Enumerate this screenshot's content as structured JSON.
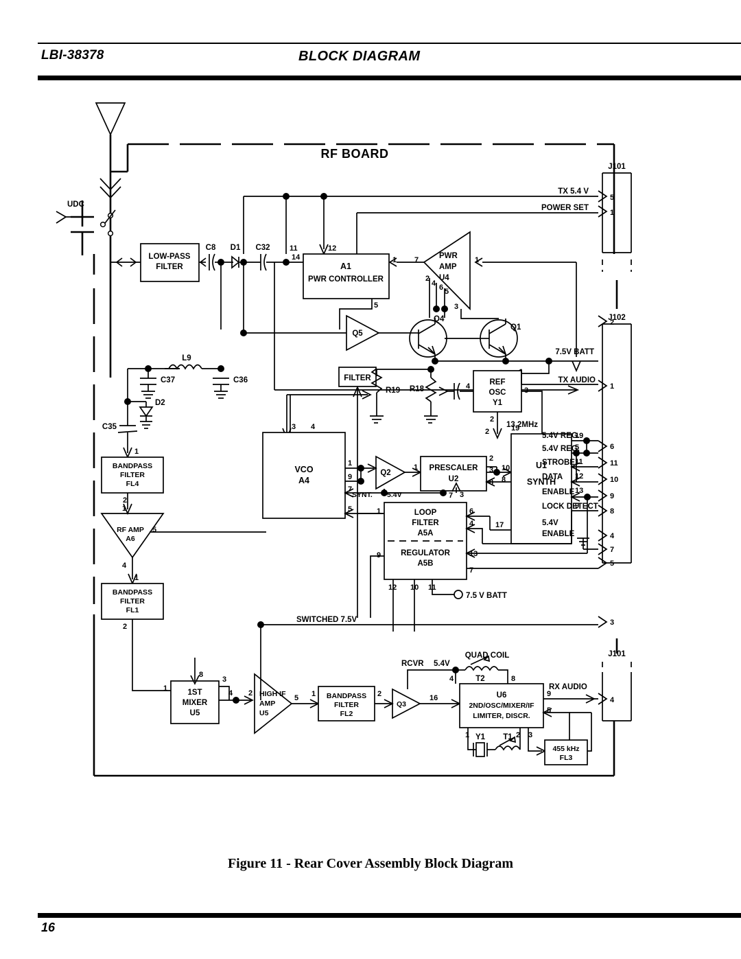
{
  "header": {
    "doc_id": "LBI-38378",
    "title": "BLOCK DIAGRAM"
  },
  "footer": {
    "caption": "Figure 11 - Rear Cover Assembly Block Diagram",
    "page_number": "16"
  },
  "diagram": {
    "board_label": "RF BOARD",
    "antenna_label": "UDC",
    "connectors": [
      {
        "name": "J101",
        "position": "top-right",
        "pins": [
          "5",
          "1"
        ]
      },
      {
        "name": "J102",
        "position": "mid-right",
        "pins": [
          "2"
        ]
      },
      {
        "name": "J101",
        "position": "bottom-right",
        "pins": [
          "4"
        ]
      }
    ],
    "blocks": {
      "low_pass_filter": {
        "l1": "LOW-PASS",
        "l2": "FILTER"
      },
      "pwr_controller": {
        "l1": "A1",
        "l2": "PWR CONTROLLER",
        "pins": [
          "14",
          "11",
          "12",
          "1",
          "5"
        ]
      },
      "pwr_amp": {
        "l1": "PWR",
        "l2": "AMP",
        "l3": "U4",
        "pins": [
          "7",
          "1",
          "2",
          "4",
          "6",
          "5",
          "3"
        ]
      },
      "filter_small": {
        "l1": "FILTER"
      },
      "ref_osc": {
        "l1": "REF",
        "l2": "OSC",
        "l3": "Y1",
        "pins": [
          "4",
          "3",
          "2"
        ],
        "freq": "13.2MHz"
      },
      "vco": {
        "l1": "VCO",
        "l2": "A4",
        "pins": [
          "3",
          "4",
          "1",
          "9",
          "7",
          "5"
        ]
      },
      "prescaler": {
        "l1": "PRESCALER",
        "l2": "U2",
        "pins": [
          "1",
          "2",
          "3",
          "7",
          "8"
        ]
      },
      "synth": {
        "l1": "U1",
        "l2": "SYNTH",
        "pins": [
          "2",
          "19",
          "5",
          "11",
          "12",
          "13",
          "9",
          "10",
          "8",
          "17"
        ]
      },
      "loop_filter": {
        "l1": "LOOP",
        "l2": "FILTER",
        "l3": "A5A",
        "pins": [
          "1",
          "6",
          "4"
        ]
      },
      "regulator": {
        "l1": "REGULATOR",
        "l2": "A5B",
        "pins": [
          "9",
          "13",
          "7",
          "12",
          "10",
          "11"
        ]
      },
      "bandpass_fl4": {
        "l1": "BANDPASS",
        "l2": "FILTER",
        "l3": "FL4",
        "pins": [
          "1",
          "2"
        ]
      },
      "rf_amp": {
        "l1": "RF AMP",
        "l2": "A6",
        "pins": [
          "1",
          "5",
          "4"
        ]
      },
      "bandpass_fl1": {
        "l1": "BANDPASS",
        "l2": "FILTER",
        "l3": "FL1",
        "pins": [
          "1",
          "2"
        ]
      },
      "first_mixer": {
        "l1": "1ST",
        "l2": "MIXER",
        "l3": "U5",
        "pins": [
          "1",
          "8",
          "3",
          "4"
        ]
      },
      "high_if_amp": {
        "l1": "HIGH IF",
        "l2": "AMP",
        "l3": "U5",
        "pins": [
          "2",
          "5"
        ]
      },
      "bandpass_fl2": {
        "l1": "BANDPASS",
        "l2": "FILTER",
        "l3": "FL2",
        "pins": [
          "1",
          "2"
        ]
      },
      "second_osc": {
        "l1": "U6",
        "l2": "2ND/OSC/MIXER/IF",
        "l3": "LIMITER, DISCR.",
        "pins": [
          "16",
          "4",
          "8",
          "9",
          "5",
          "1",
          "2",
          "3"
        ]
      },
      "filter_fl3": {
        "l1": "455 kHz",
        "l2": "FL3"
      }
    },
    "components": [
      {
        "ref": "C8"
      },
      {
        "ref": "D1"
      },
      {
        "ref": "C32"
      },
      {
        "ref": "Q5"
      },
      {
        "ref": "Q4"
      },
      {
        "ref": "Q1"
      },
      {
        "ref": "L9"
      },
      {
        "ref": "C37"
      },
      {
        "ref": "C36"
      },
      {
        "ref": "C35"
      },
      {
        "ref": "D2"
      },
      {
        "ref": "R19"
      },
      {
        "ref": "R18"
      },
      {
        "ref": "Q2"
      },
      {
        "ref": "Q3"
      },
      {
        "ref": "T2"
      },
      {
        "ref": "T1"
      },
      {
        "ref": "Y1"
      }
    ],
    "signals": {
      "tx_54v": "TX 5.4 V",
      "power_set": "POWER SET",
      "batt_75v_j102": "7.5V BATT",
      "tx_audio": "TX AUDIO",
      "reg_54v": "5.4V REG.",
      "strobe": "STROBE",
      "data": "DATA",
      "enable": "ENABLE",
      "lock_detect": "LOCK DETECT",
      "enable_54v_l1": "5.4V",
      "enable_54v_l2": "ENABLE",
      "batt_75v_reg": "7.5 V BATT",
      "switched_75v": "SWITCHED 7.5V",
      "synt": "SYNT.",
      "synt_54v": "5.4V",
      "rcvr": "RCVR",
      "rcvr_54v": "5.4V",
      "quad_coil": "QUAD COIL",
      "rx_audio": "RX AUDIO"
    }
  }
}
